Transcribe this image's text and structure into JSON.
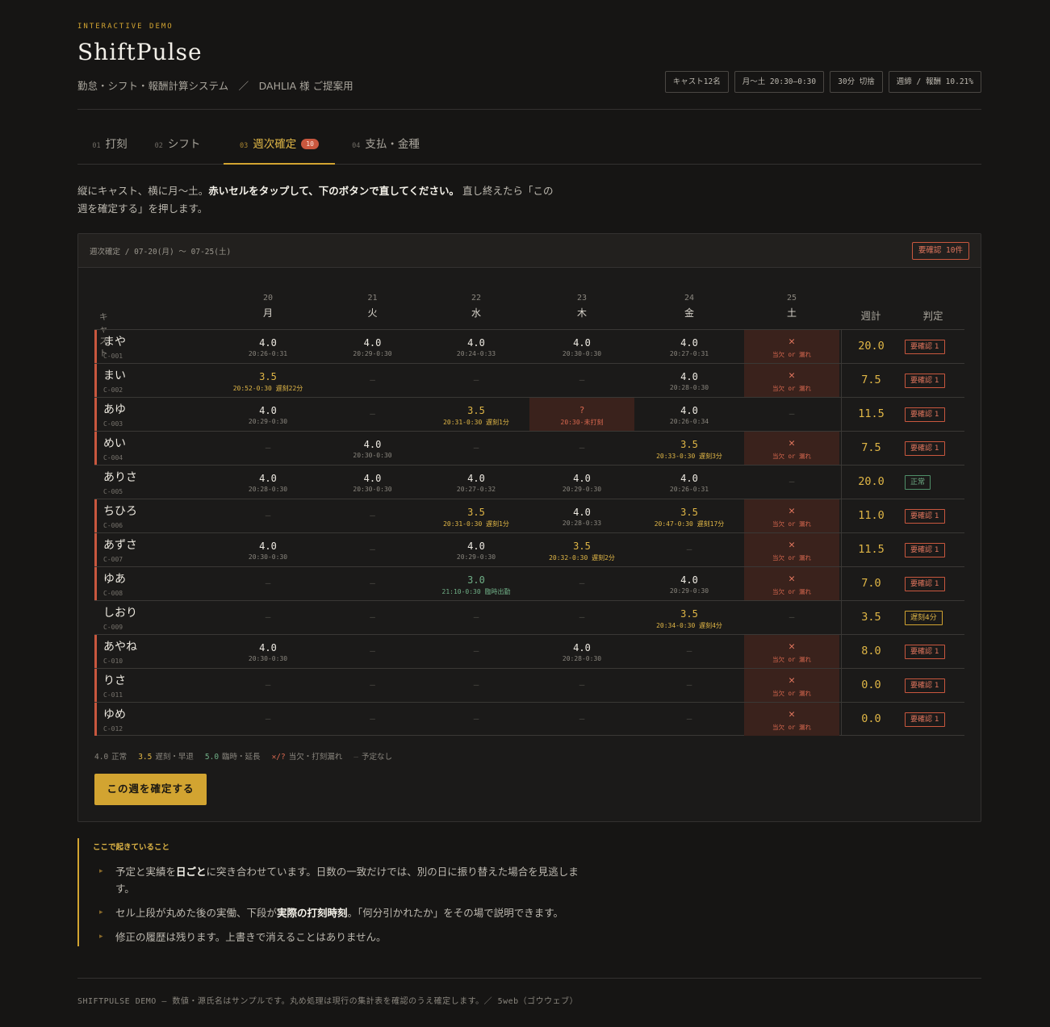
{
  "header": {
    "eyebrow": "INTERACTIVE DEMO",
    "title": "ShiftPulse",
    "subtitle": "勤怠・シフト・報酬計算システム　／　DAHLIA 様 ご提案用",
    "chips": [
      "キャスト12名",
      "月〜土 20:30–0:30",
      "30分 切捨",
      "週締 / 報酬 10.21%"
    ]
  },
  "tabs": [
    {
      "num": "01",
      "label": "打刻",
      "badge": ""
    },
    {
      "num": "02",
      "label": "シフト",
      "badge": ""
    },
    {
      "num": "03",
      "label": "週次確定",
      "badge": "10"
    },
    {
      "num": "04",
      "label": "支払・金種",
      "badge": ""
    }
  ],
  "instructions": {
    "part1": "縦にキャスト、横に月〜土。",
    "bold": "赤いセルをタップして、下のボタンで直してください。",
    "part2": "直し終えたら「この週を確定する」を押します。"
  },
  "panel": {
    "title": "週次確定 / 07-20(月) 〜 07-25(土)",
    "alert": "要確認 10件",
    "cast_header": "キャスト",
    "total_header": "週計",
    "judge_header": "判定",
    "days": [
      {
        "date": "20",
        "weekday": "月"
      },
      {
        "date": "21",
        "weekday": "火"
      },
      {
        "date": "22",
        "weekday": "水"
      },
      {
        "date": "23",
        "weekday": "木"
      },
      {
        "date": "24",
        "weekday": "金"
      },
      {
        "date": "25",
        "weekday": "土"
      }
    ],
    "rows": [
      {
        "name": "まや",
        "id": "C-001",
        "flag": true,
        "cells": [
          {
            "s": "ok",
            "v": "4.0",
            "t": "20:26-0:31"
          },
          {
            "s": "ok",
            "v": "4.0",
            "t": "20:29-0:30"
          },
          {
            "s": "ok",
            "v": "4.0",
            "t": "20:24-0:33"
          },
          {
            "s": "ok",
            "v": "4.0",
            "t": "20:30-0:30"
          },
          {
            "s": "ok",
            "v": "4.0",
            "t": "20:27-0:31"
          },
          {
            "s": "err",
            "v": "✕",
            "t": "当欠 or 漏れ"
          }
        ],
        "total": "20.0",
        "judge": "要確認 1",
        "judge_type": "bad"
      },
      {
        "name": "まい",
        "id": "C-002",
        "flag": true,
        "cells": [
          {
            "s": "late",
            "v": "3.5",
            "t": "20:52-0:30 遅刻22分"
          },
          {
            "s": "dash",
            "v": "—",
            "t": ""
          },
          {
            "s": "dash",
            "v": "—",
            "t": ""
          },
          {
            "s": "dash",
            "v": "—",
            "t": ""
          },
          {
            "s": "ok",
            "v": "4.0",
            "t": "20:28-0:30"
          },
          {
            "s": "err",
            "v": "✕",
            "t": "当欠 or 漏れ"
          }
        ],
        "total": "7.5",
        "judge": "要確認 1",
        "judge_type": "bad"
      },
      {
        "name": "あゆ",
        "id": "C-003",
        "flag": true,
        "cells": [
          {
            "s": "ok",
            "v": "4.0",
            "t": "20:29-0:30"
          },
          {
            "s": "dash",
            "v": "—",
            "t": ""
          },
          {
            "s": "late",
            "v": "3.5",
            "t": "20:31-0:30 遅刻1分"
          },
          {
            "s": "unp",
            "v": "?",
            "t": "20:30-未打刻"
          },
          {
            "s": "ok",
            "v": "4.0",
            "t": "20:26-0:34"
          },
          {
            "s": "dash",
            "v": "—",
            "t": ""
          }
        ],
        "total": "11.5",
        "judge": "要確認 1",
        "judge_type": "bad"
      },
      {
        "name": "めい",
        "id": "C-004",
        "flag": true,
        "cells": [
          {
            "s": "dash",
            "v": "—",
            "t": ""
          },
          {
            "s": "ok",
            "v": "4.0",
            "t": "20:30-0:30"
          },
          {
            "s": "dash",
            "v": "—",
            "t": ""
          },
          {
            "s": "dash",
            "v": "—",
            "t": ""
          },
          {
            "s": "late",
            "v": "3.5",
            "t": "20:33-0:30 遅刻3分"
          },
          {
            "s": "err",
            "v": "✕",
            "t": "当欠 or 漏れ"
          }
        ],
        "total": "7.5",
        "judge": "要確認 1",
        "judge_type": "bad"
      },
      {
        "name": "ありさ",
        "id": "C-005",
        "flag": false,
        "cells": [
          {
            "s": "ok",
            "v": "4.0",
            "t": "20:28-0:30"
          },
          {
            "s": "ok",
            "v": "4.0",
            "t": "20:30-0:30"
          },
          {
            "s": "ok",
            "v": "4.0",
            "t": "20:27-0:32"
          },
          {
            "s": "ok",
            "v": "4.0",
            "t": "20:29-0:30"
          },
          {
            "s": "ok",
            "v": "4.0",
            "t": "20:26-0:31"
          },
          {
            "s": "dash",
            "v": "—",
            "t": ""
          }
        ],
        "total": "20.0",
        "judge": "正常",
        "judge_type": "ok"
      },
      {
        "name": "ちひろ",
        "id": "C-006",
        "flag": true,
        "cells": [
          {
            "s": "dash",
            "v": "—",
            "t": ""
          },
          {
            "s": "dash",
            "v": "—",
            "t": ""
          },
          {
            "s": "late",
            "v": "3.5",
            "t": "20:31-0:30 遅刻1分"
          },
          {
            "s": "ok",
            "v": "4.0",
            "t": "20:28-0:33"
          },
          {
            "s": "late",
            "v": "3.5",
            "t": "20:47-0:30 遅刻17分"
          },
          {
            "s": "err",
            "v": "✕",
            "t": "当欠 or 漏れ"
          }
        ],
        "total": "11.0",
        "judge": "要確認 1",
        "judge_type": "bad"
      },
      {
        "name": "あずさ",
        "id": "C-007",
        "flag": true,
        "cells": [
          {
            "s": "ok",
            "v": "4.0",
            "t": "20:30-0:30"
          },
          {
            "s": "dash",
            "v": "—",
            "t": ""
          },
          {
            "s": "ok",
            "v": "4.0",
            "t": "20:29-0:30"
          },
          {
            "s": "late",
            "v": "3.5",
            "t": "20:32-0:30 遅刻2分"
          },
          {
            "s": "dash",
            "v": "—",
            "t": ""
          },
          {
            "s": "err",
            "v": "✕",
            "t": "当欠 or 漏れ"
          }
        ],
        "total": "11.5",
        "judge": "要確認 1",
        "judge_type": "bad"
      },
      {
        "name": "ゆあ",
        "id": "C-008",
        "flag": true,
        "cells": [
          {
            "s": "dash",
            "v": "—",
            "t": ""
          },
          {
            "s": "dash",
            "v": "—",
            "t": ""
          },
          {
            "s": "extra",
            "v": "3.0",
            "t": "21:10-0:30 臨時出勤"
          },
          {
            "s": "dash",
            "v": "—",
            "t": ""
          },
          {
            "s": "ok",
            "v": "4.0",
            "t": "20:29-0:30"
          },
          {
            "s": "err",
            "v": "✕",
            "t": "当欠 or 漏れ"
          }
        ],
        "total": "7.0",
        "judge": "要確認 1",
        "judge_type": "bad"
      },
      {
        "name": "しおり",
        "id": "C-009",
        "flag": false,
        "cells": [
          {
            "s": "dash",
            "v": "—",
            "t": ""
          },
          {
            "s": "dash",
            "v": "—",
            "t": ""
          },
          {
            "s": "dash",
            "v": "—",
            "t": ""
          },
          {
            "s": "dash",
            "v": "—",
            "t": ""
          },
          {
            "s": "late",
            "v": "3.5",
            "t": "20:34-0:30 遅刻4分"
          },
          {
            "s": "dash",
            "v": "—",
            "t": ""
          }
        ],
        "total": "3.5",
        "judge": "遅刻4分",
        "judge_type": "warn"
      },
      {
        "name": "あやね",
        "id": "C-010",
        "flag": true,
        "cells": [
          {
            "s": "ok",
            "v": "4.0",
            "t": "20:30-0:30"
          },
          {
            "s": "dash",
            "v": "—",
            "t": ""
          },
          {
            "s": "dash",
            "v": "—",
            "t": ""
          },
          {
            "s": "ok",
            "v": "4.0",
            "t": "20:28-0:30"
          },
          {
            "s": "dash",
            "v": "—",
            "t": ""
          },
          {
            "s": "err",
            "v": "✕",
            "t": "当欠 or 漏れ"
          }
        ],
        "total": "8.0",
        "judge": "要確認 1",
        "judge_type": "bad"
      },
      {
        "name": "りさ",
        "id": "C-011",
        "flag": true,
        "cells": [
          {
            "s": "dash",
            "v": "—",
            "t": ""
          },
          {
            "s": "dash",
            "v": "—",
            "t": ""
          },
          {
            "s": "dash",
            "v": "—",
            "t": ""
          },
          {
            "s": "dash",
            "v": "—",
            "t": ""
          },
          {
            "s": "dash",
            "v": "—",
            "t": ""
          },
          {
            "s": "err",
            "v": "✕",
            "t": "当欠 or 漏れ"
          }
        ],
        "total": "0.0",
        "judge": "要確認 1",
        "judge_type": "bad"
      },
      {
        "name": "ゆめ",
        "id": "C-012",
        "flag": true,
        "cells": [
          {
            "s": "dash",
            "v": "—",
            "t": ""
          },
          {
            "s": "dash",
            "v": "—",
            "t": ""
          },
          {
            "s": "dash",
            "v": "—",
            "t": ""
          },
          {
            "s": "dash",
            "v": "—",
            "t": ""
          },
          {
            "s": "dash",
            "v": "—",
            "t": ""
          },
          {
            "s": "err",
            "v": "✕",
            "t": "当欠 or 漏れ"
          }
        ],
        "total": "0.0",
        "judge": "要確認 1",
        "judge_type": "bad"
      }
    ],
    "legend": [
      {
        "key": "4.0",
        "label": "正常",
        "color": "#8a867e"
      },
      {
        "key": "3.5",
        "label": "遅刻・早退",
        "color": "#e0b646"
      },
      {
        "key": "5.0",
        "label": "臨時・延長",
        "color": "#6fae86"
      },
      {
        "key": "✕/?",
        "label": "当欠・打刻漏れ",
        "color": "#d8684f"
      },
      {
        "key": "—",
        "label": "予定なし",
        "color": "#4d4a46"
      }
    ],
    "confirm_button": "この週を確定する"
  },
  "explain": {
    "title": "ここで起きていること",
    "items": [
      {
        "pre": "予定と実績を",
        "bold": "日ごと",
        "post": "に突き合わせています。日数の一致だけでは、別の日に振り替えた場合を見逃します。"
      },
      {
        "pre": "セル上段が丸めた後の実働、下段が",
        "bold": "実際の打刻時刻",
        "post": "。「何分引かれたか」をその場で説明できます。"
      },
      {
        "pre": "修正の履歴は残ります。上書きで消えることはありません。",
        "bold": "",
        "post": ""
      }
    ]
  },
  "footer": "SHIFTPULSE DEMO — 数値・源氏名はサンプルです。丸め処理は現行の集計表を確認のうえ確定します。／ 5web（ゴウウェブ）"
}
